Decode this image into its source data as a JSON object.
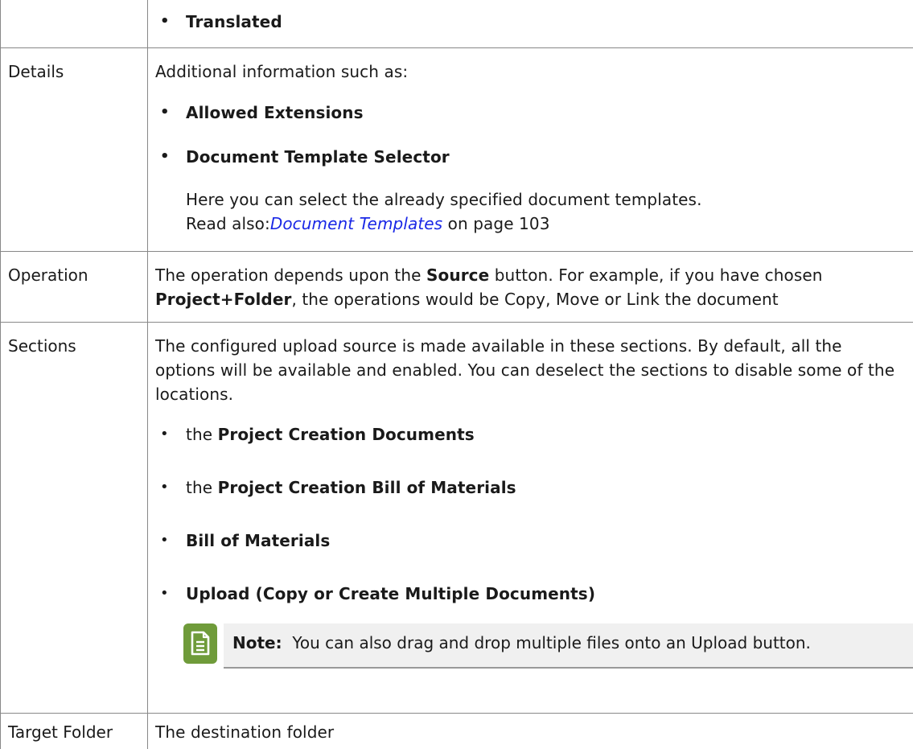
{
  "rows": {
    "top": {
      "bullet": "Translated"
    },
    "details": {
      "label": "Details",
      "intro": "Additional information such as:",
      "bullet1": "Allowed Extensions",
      "bullet2": "Document Template Selector",
      "desc_part1": "Here you can select the already specified document templates. Read also:",
      "desc_link": "Document Templates",
      "desc_part2": " on page 103"
    },
    "operation": {
      "label": "Operation",
      "text1": "The operation depends upon the ",
      "bold1": "Source",
      "text2": " button. For example, if you have chosen ",
      "bold2": "Project+Folder",
      "text3": ", the operations would be Copy, Move or Link the document"
    },
    "sections": {
      "label": "Sections",
      "intro": "The configured upload source is made available in these sections. By default, all the options will be available and enabled. You can deselect the sections to disable some of the locations.",
      "items": [
        {
          "prefix": "the ",
          "bold": "Project Creation Documents"
        },
        {
          "prefix": "the ",
          "bold": "Project Creation Bill of Materials"
        },
        {
          "prefix": "",
          "bold": "Bill of Materials"
        },
        {
          "prefix": "",
          "bold": "Upload (Copy or Create Multiple Documents)"
        }
      ],
      "note_label": "Note:",
      "note_text": "You can also drag and drop multiple files onto an Upload button."
    },
    "target": {
      "label": "Target Folder",
      "text": "The destination folder"
    }
  },
  "colors": {
    "link": "#1a28e6",
    "note_icon": "#6f9b3a",
    "note_bg": "#f0f0f0"
  },
  "icons": {
    "note": "note-document-icon"
  }
}
